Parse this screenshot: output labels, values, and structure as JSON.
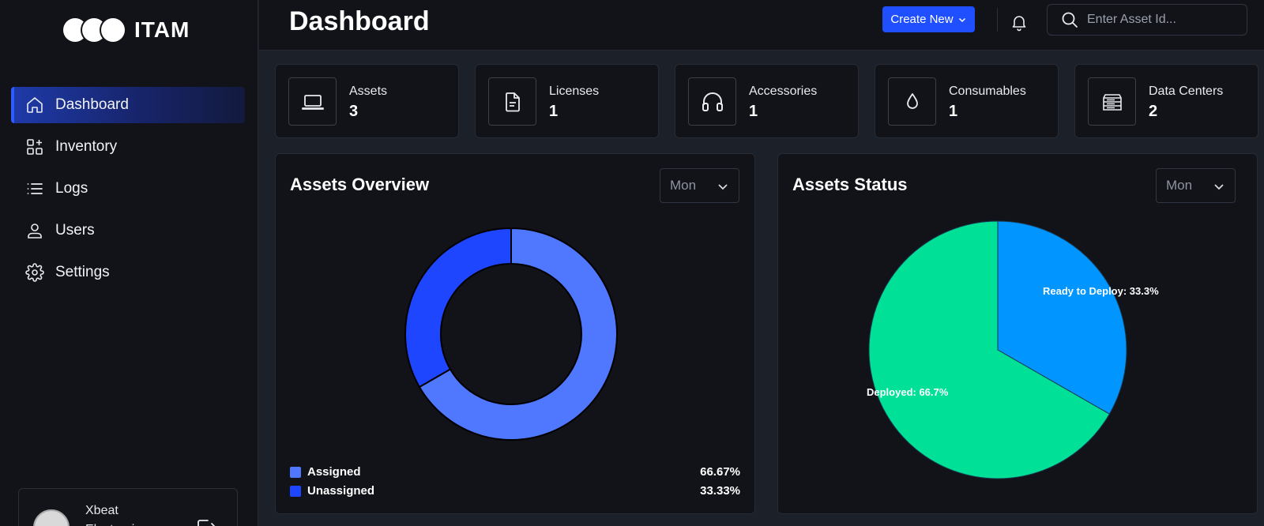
{
  "brand": {
    "name": "ITAM"
  },
  "sidebar": {
    "items": [
      {
        "label": "Dashboard",
        "icon": "home-icon",
        "active": true
      },
      {
        "label": "Inventory",
        "icon": "grid-plus-icon",
        "active": false
      },
      {
        "label": "Logs",
        "icon": "list-icon",
        "active": false
      },
      {
        "label": "Users",
        "icon": "user-icon",
        "active": false
      },
      {
        "label": "Settings",
        "icon": "gear-icon",
        "active": false
      }
    ],
    "user": {
      "name": "Xbeat Electronics"
    }
  },
  "header": {
    "title": "Dashboard",
    "create_label": "Create New",
    "search_placeholder": "Enter Asset Id..."
  },
  "stats": [
    {
      "label": "Assets",
      "value": "3",
      "icon": "laptop-icon"
    },
    {
      "label": "Licenses",
      "value": "1",
      "icon": "document-icon"
    },
    {
      "label": "Accessories",
      "value": "1",
      "icon": "headphones-icon"
    },
    {
      "label": "Consumables",
      "value": "1",
      "icon": "droplet-icon"
    },
    {
      "label": "Data Centers",
      "value": "2",
      "icon": "server-icon"
    }
  ],
  "colors": {
    "accent": "#1f4fff",
    "assigned": "#5078ff",
    "unassigned": "#1e46ff",
    "deployed": "#00e096",
    "ready": "#0095ff"
  },
  "panels": {
    "overview": {
      "title": "Assets Overview",
      "period": "Mon",
      "legend": [
        {
          "label": "Assigned",
          "pct": "66.67%"
        },
        {
          "label": "Unassigned",
          "pct": "33.33%"
        }
      ]
    },
    "status": {
      "title": "Assets Status",
      "period": "Mon"
    }
  },
  "chart_data": [
    {
      "type": "pie",
      "title": "Assets Overview",
      "categories": [
        "Assigned",
        "Unassigned"
      ],
      "values": [
        66.67,
        33.33
      ],
      "donut": true,
      "legend": "bottom"
    },
    {
      "type": "pie",
      "title": "Assets Status",
      "categories": [
        "Ready to Deploy",
        "Deployed"
      ],
      "values": [
        33.3,
        66.7
      ],
      "labels": [
        "Ready to Deploy: 33.3%",
        "Deployed: 66.7%"
      ]
    }
  ]
}
